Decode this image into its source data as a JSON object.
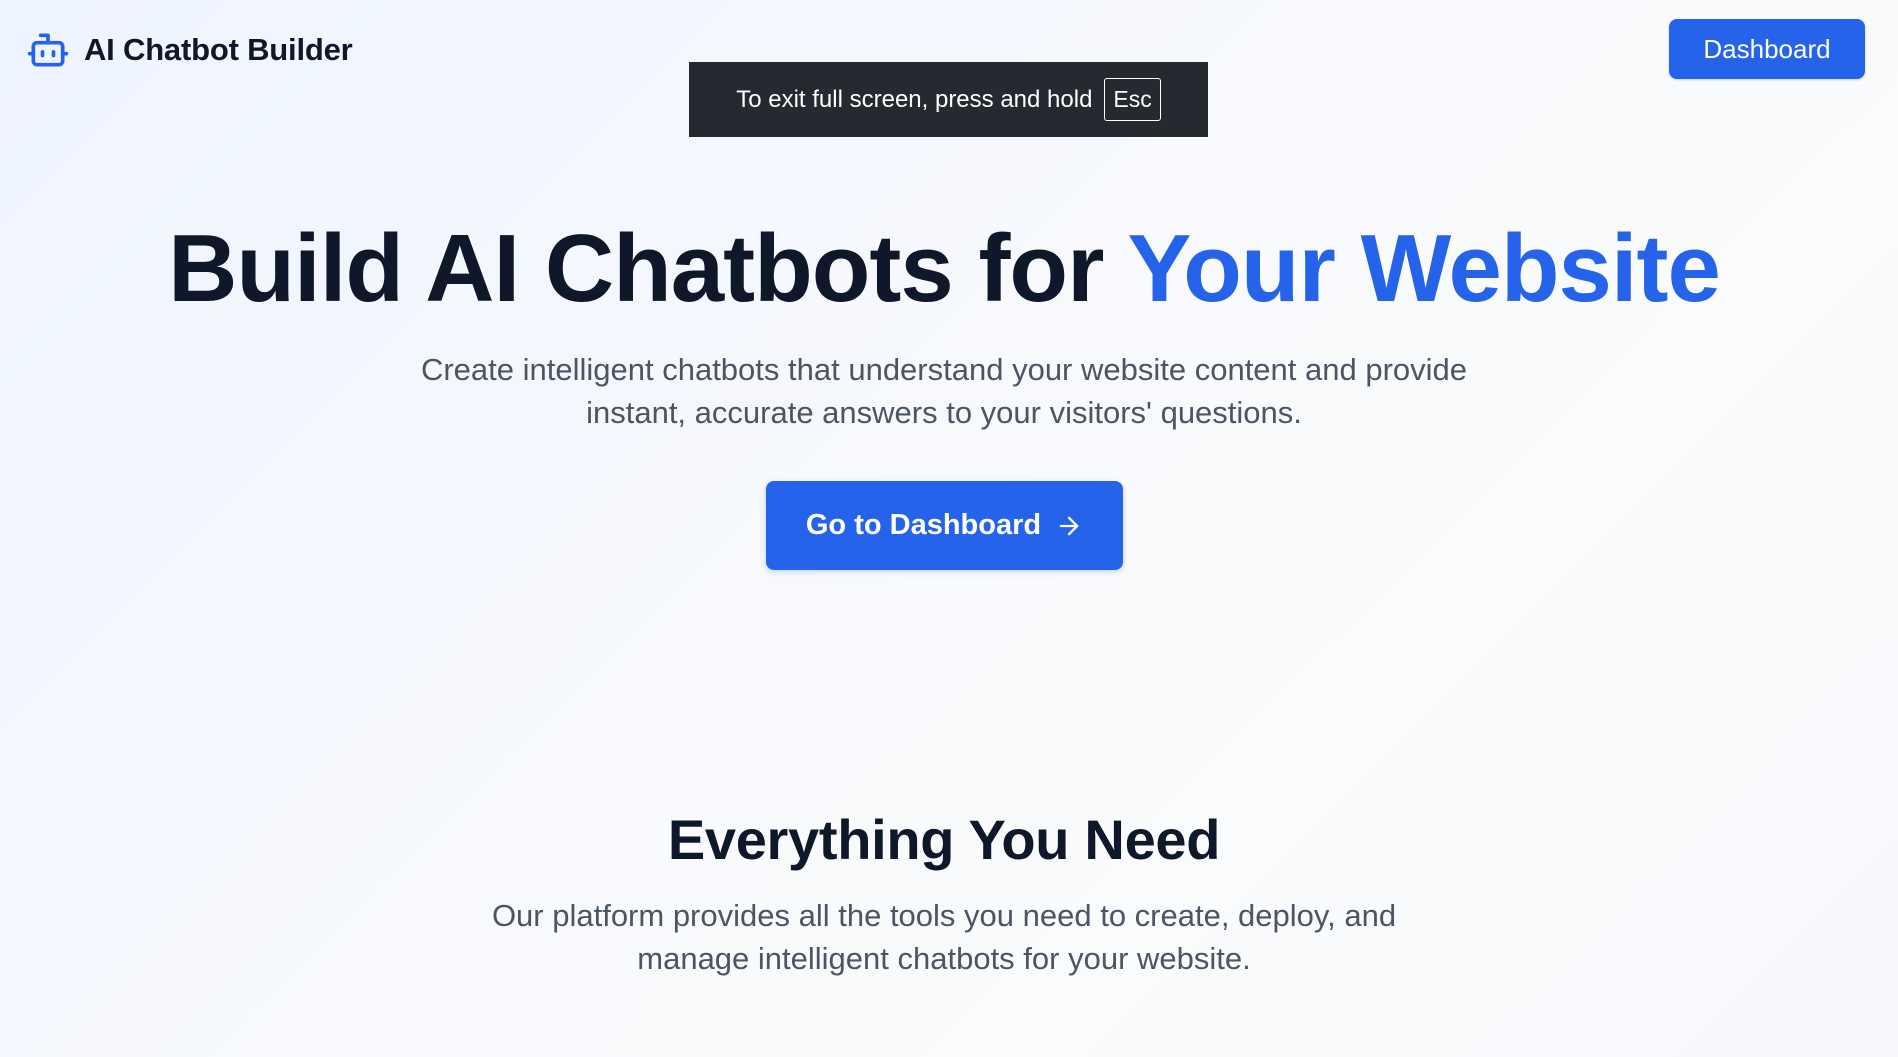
{
  "header": {
    "brand_name": "AI Chatbot Builder",
    "brand_icon": "robot-icon",
    "dashboard_label": "Dashboard"
  },
  "fullscreen_notice": {
    "message": "To exit full screen, press and hold",
    "key": "Esc"
  },
  "hero": {
    "title_main": "Build AI Chatbots for ",
    "title_accent": "Your Website",
    "subtitle": "Create intelligent chatbots that understand your website content and provide instant, accurate answers to your visitors' questions.",
    "cta_label": "Go to Dashboard",
    "cta_icon": "arrow-right-icon"
  },
  "features": {
    "title": "Everything You Need",
    "subtitle": "Our platform provides all the tools you need to create, deploy, and manage intelligent chatbots for your website."
  },
  "colors": {
    "accent": "#2563eb",
    "text_dark": "#0f172a",
    "text_muted": "#4b5563",
    "notice_bg": "#26292f"
  }
}
